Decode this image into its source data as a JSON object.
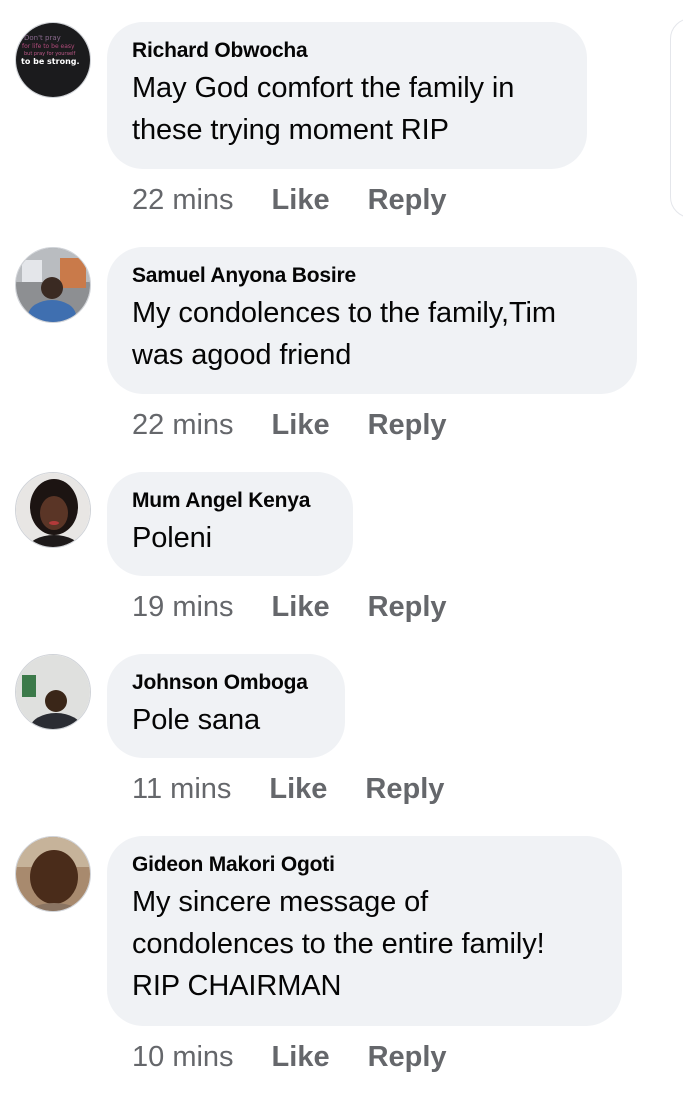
{
  "comments": [
    {
      "author": "Richard Obwocha",
      "lines": [
        "May God comfort the family in",
        "these trying moment RIP"
      ],
      "time": "22 mins",
      "like": "Like",
      "reply": "Reply",
      "avatar": "quote-image",
      "avatar_texts": [
        "Don't pray",
        "for life to be easy",
        "but pray for yourself",
        "to be strong."
      ]
    },
    {
      "author": "Samuel Anyona Bosire",
      "lines": [
        "My condolences to the family,Tim",
        "was agood friend"
      ],
      "time": "22 mins",
      "like": "Like",
      "reply": "Reply",
      "avatar": "person-photo"
    },
    {
      "author": "Mum Angel Kenya",
      "lines": [
        "Poleni"
      ],
      "time": "19 mins",
      "like": "Like",
      "reply": "Reply",
      "avatar": "person-photo"
    },
    {
      "author": "Johnson Omboga",
      "lines": [
        "Pole sana"
      ],
      "time": "11 mins",
      "like": "Like",
      "reply": "Reply",
      "avatar": "person-photo"
    },
    {
      "author": "Gideon Makori Ogoti",
      "lines": [
        "My sincere message of",
        "condolences to the entire family!",
        "RIP CHAIRMAN"
      ],
      "time": "10 mins",
      "like": "Like",
      "reply": "Reply",
      "avatar": "person-photo"
    }
  ],
  "colors": {
    "bubble": "#f0f2f5",
    "name": "#050505",
    "meta": "#65676b"
  }
}
